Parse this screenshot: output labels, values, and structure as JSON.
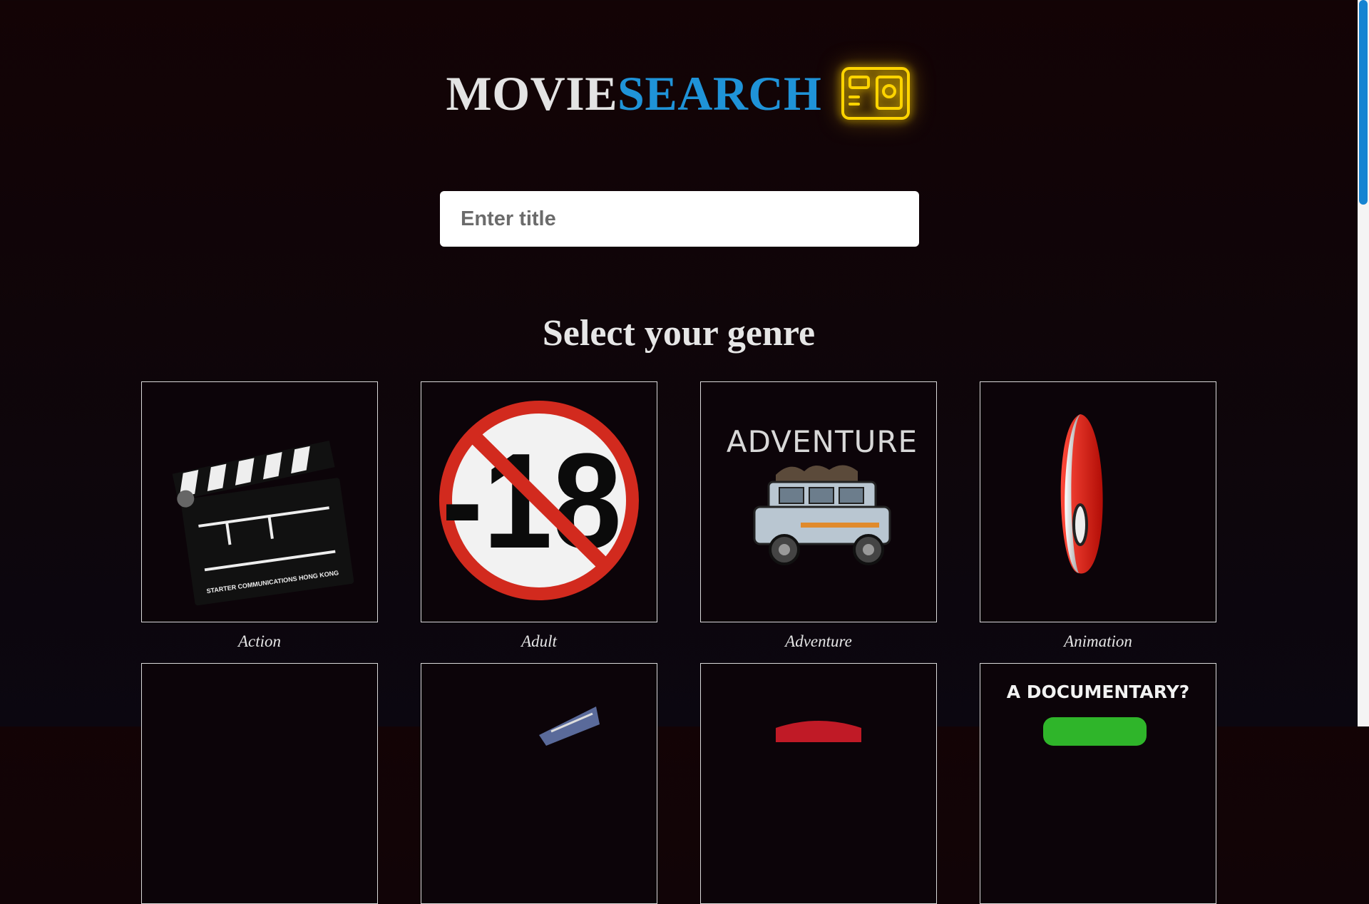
{
  "header": {
    "logo_part1": "MOVIE",
    "logo_part2": "SEARCH",
    "logo_icon": "neon-camera-icon",
    "accent": "#1f93d8",
    "neon": "#ffd400"
  },
  "search": {
    "placeholder": "Enter title",
    "value": ""
  },
  "genres_heading": "Select your genre",
  "genres": [
    {
      "label": "Action",
      "icon": "clapperboard-icon",
      "board_text": "STARTER COMMUNICATIONS HONG KONG"
    },
    {
      "label": "Adult",
      "icon": "no-under-18-icon",
      "sign_text": "-18"
    },
    {
      "label": "Adventure",
      "icon": "adventure-jeep-icon",
      "sign_text": "ADVENTURE"
    },
    {
      "label": "Animation",
      "icon": "pokeball-icon"
    },
    {
      "label": "",
      "icon": "genre-image"
    },
    {
      "label": "",
      "icon": "genre-image"
    },
    {
      "label": "",
      "icon": "genre-image"
    },
    {
      "label": "",
      "icon": "documentary-icon",
      "sign_text": "A DOCUMENTARY?"
    }
  ],
  "scrollbar": {
    "position": 0
  }
}
